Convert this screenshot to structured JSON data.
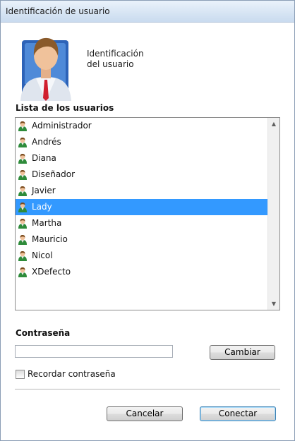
{
  "window": {
    "title": "Identificación de usuario"
  },
  "header": {
    "caption_line1": "Identificación",
    "caption_line2": "del usuario",
    "avatar_icon": "user-avatar-icon"
  },
  "users": {
    "label": "Lista de los usuarios",
    "items": [
      {
        "name": "Administrador",
        "selected": false
      },
      {
        "name": "Andrés",
        "selected": false
      },
      {
        "name": "Diana",
        "selected": false
      },
      {
        "name": "Diseñador",
        "selected": false
      },
      {
        "name": "Javier",
        "selected": false
      },
      {
        "name": "Lady",
        "selected": true
      },
      {
        "name": "Martha",
        "selected": false
      },
      {
        "name": "Mauricio",
        "selected": false
      },
      {
        "name": "Nicol",
        "selected": false
      },
      {
        "name": "XDefecto",
        "selected": false
      }
    ],
    "item_icon": "user-icon",
    "selection_color": "#3399ff"
  },
  "password": {
    "label": "Contraseña",
    "value": "",
    "change_button": "Cambiar"
  },
  "remember": {
    "label": "Recordar contraseña",
    "checked": false
  },
  "actions": {
    "cancel": "Cancelar",
    "connect": "Conectar"
  }
}
